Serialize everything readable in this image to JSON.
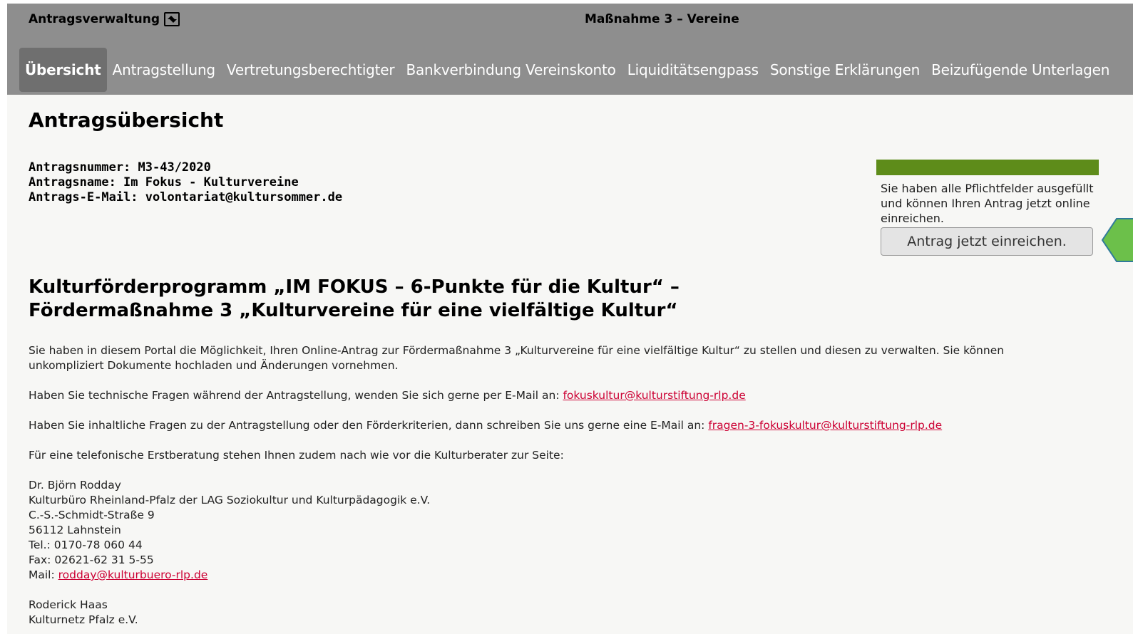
{
  "header": {
    "app_title": "Antragsverwaltung",
    "window_title": "Maßnahme 3 – Vereine"
  },
  "tabs": [
    {
      "label": "Übersicht",
      "active": true
    },
    {
      "label": "Antragstellung"
    },
    {
      "label": "Vertretungsberechtigter"
    },
    {
      "label": "Bankverbindung Vereinskonto"
    },
    {
      "label": "Liquiditätsengpass"
    },
    {
      "label": "Sonstige Erklärungen"
    },
    {
      "label": "Beizufügende Unterlagen"
    }
  ],
  "page_title": "Antragsübersicht",
  "meta": {
    "number": "Antragsnummer: M3-43/2020",
    "name": "Antragsname: Im Fokus - Kulturvereine",
    "email": "Antrags-E-Mail: volontariat@kultursommer.de"
  },
  "status": {
    "progress": 1.0,
    "progress_color": "#5e8c1a",
    "text": "Sie haben alle Pflichtfelder ausgefüllt und können Ihren Antrag jetzt online einreichen.",
    "submit_label": "Antrag jetzt einreichen."
  },
  "headline": {
    "line1": "Kulturförderprogramm „IM FOKUS – 6-Punkte für die Kultur“ –",
    "line2": "Fördermaßnahme 3 „Kulturvereine für eine vielfältige Kultur“"
  },
  "content": {
    "intro": "Sie haben in diesem Portal die Möglichkeit, Ihren Online-Antrag zur Fördermaßnahme 3 „Kulturvereine für eine vielfältige Kultur“ zu stellen und diesen zu verwalten. Sie können unkompliziert Dokumente hochladen und Änderungen vornehmen.",
    "tech_question": "Haben Sie technische Fragen während der Antragstellung, wenden Sie sich gerne per E-Mail an: ",
    "tech_email": "fokuskultur@kulturstiftung-rlp.de",
    "content_question": "Haben Sie inhaltliche Fragen zu der Antragstellung oder den Förderkriterien, dann schreiben Sie uns gerne eine E-Mail an: ",
    "content_email": "fragen-3-fokuskultur@kulturstiftung-rlp.de",
    "phone_intro": "Für eine telefonische Erstberatung stehen Ihnen zudem nach wie vor die Kulturberater zur Seite:",
    "contact1": {
      "name": "Dr. Björn Rodday",
      "org": "Kulturbüro Rheinland-Pfalz der LAG Soziokultur und Kulturpädagogik e.V.",
      "street": "C.-S.-Schmidt-Straße 9",
      "city": "56112 Lahnstein",
      "tel": "Tel.: 0170-78 060 44",
      "fax": "Fax: 02621-62 31 5-55",
      "mail_label": "Mail: ",
      "mail": "rodday@kulturbuero-rlp.de"
    },
    "contact2": {
      "name": "Roderick Haas",
      "org": "Kulturnetz Pfalz e.V."
    }
  },
  "colors": {
    "header_bg": "#8e8e8e",
    "active_tab_bg": "#6f6f6f",
    "link": "#cc0033",
    "pointer_accent": "#6cc04a"
  }
}
